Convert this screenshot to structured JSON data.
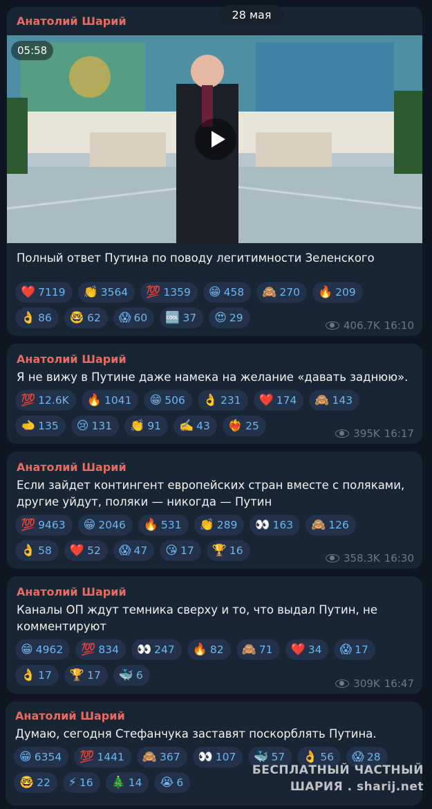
{
  "date_badge": "28 мая",
  "messages": [
    {
      "author": "Анатолий Шарий",
      "video_duration": "05:58",
      "text": "Полный ответ Путина по поводу легитимности Зеленского",
      "reactions": [
        {
          "emoji": "❤️",
          "count": "7119"
        },
        {
          "emoji": "👏",
          "count": "3564"
        },
        {
          "emoji": "💯",
          "count": "1359"
        },
        {
          "emoji": "😁",
          "count": "458"
        },
        {
          "emoji": "🙈",
          "count": "270"
        },
        {
          "emoji": "🔥",
          "count": "209"
        },
        {
          "emoji": "👌",
          "count": "86"
        },
        {
          "emoji": "🤓",
          "count": "62"
        },
        {
          "emoji": "😱",
          "count": "60"
        },
        {
          "emoji": "🆒",
          "count": "37"
        },
        {
          "emoji": "😍",
          "count": "29"
        }
      ],
      "views": "406.7K",
      "time": "16:10"
    },
    {
      "author": "Анатолий Шарий",
      "text": "Я не вижу в Путине даже намека на желание «давать заднюю».",
      "reactions": [
        {
          "emoji": "💯",
          "count": "12.6K"
        },
        {
          "emoji": "🔥",
          "count": "1041"
        },
        {
          "emoji": "😁",
          "count": "506"
        },
        {
          "emoji": "👌",
          "count": "231"
        },
        {
          "emoji": "❤️",
          "count": "174"
        },
        {
          "emoji": "🙈",
          "count": "143"
        },
        {
          "emoji": "🫲",
          "count": "135"
        },
        {
          "emoji": "😢",
          "count": "131"
        },
        {
          "emoji": "👏",
          "count": "91"
        },
        {
          "emoji": "✍️",
          "count": "43"
        },
        {
          "emoji": "❤️‍🔥",
          "count": "25"
        }
      ],
      "views": "395K",
      "time": "16:17"
    },
    {
      "author": "Анатолий Шарий",
      "text": "Если зайдет контингент европейских стран вместе с поляками,\nдругие уйдут, поляки — никогда — Путин",
      "reactions": [
        {
          "emoji": "💯",
          "count": "9463"
        },
        {
          "emoji": "😁",
          "count": "2046"
        },
        {
          "emoji": "🔥",
          "count": "531"
        },
        {
          "emoji": "👏",
          "count": "289"
        },
        {
          "emoji": "👀",
          "count": "163"
        },
        {
          "emoji": "🙈",
          "count": "126"
        },
        {
          "emoji": "👌",
          "count": "58"
        },
        {
          "emoji": "❤️",
          "count": "52"
        },
        {
          "emoji": "😱",
          "count": "47"
        },
        {
          "emoji": "😘",
          "count": "17"
        },
        {
          "emoji": "🏆",
          "count": "16"
        }
      ],
      "views": "358.3K",
      "time": "16:30"
    },
    {
      "author": "Анатолий Шарий",
      "text": "Каналы ОП ждут темника сверху и то, что выдал Путин, не\nкомментируют",
      "reactions": [
        {
          "emoji": "😁",
          "count": "4962"
        },
        {
          "emoji": "💯",
          "count": "834"
        },
        {
          "emoji": "👀",
          "count": "247"
        },
        {
          "emoji": "🔥",
          "count": "82"
        },
        {
          "emoji": "🙈",
          "count": "71"
        },
        {
          "emoji": "❤️",
          "count": "34"
        },
        {
          "emoji": "😱",
          "count": "17"
        },
        {
          "emoji": "👌",
          "count": "17"
        },
        {
          "emoji": "🏆",
          "count": "17"
        },
        {
          "emoji": "🐳",
          "count": "6"
        }
      ],
      "views": "309K",
      "time": "16:47"
    },
    {
      "author": "Анатолий Шарий",
      "text": "Думаю, сегодня Стефанчука заставят поскорблять Путина.",
      "reactions": [
        {
          "emoji": "😁",
          "count": "6354"
        },
        {
          "emoji": "💯",
          "count": "1441"
        },
        {
          "emoji": "🙈",
          "count": "367"
        },
        {
          "emoji": "👀",
          "count": "107"
        },
        {
          "emoji": "🐳",
          "count": "57"
        },
        {
          "emoji": "👌",
          "count": "56"
        },
        {
          "emoji": "😱",
          "count": "28"
        },
        {
          "emoji": "🤓",
          "count": "22"
        },
        {
          "emoji": "⚡",
          "count": "16"
        },
        {
          "emoji": "🎄",
          "count": "14"
        },
        {
          "emoji": "😭",
          "count": "6"
        }
      ],
      "views": "",
      "time": ""
    }
  ],
  "watermark": {
    "line1": "БЕСПЛАТНЫЙ ЧАСТНЫЙ",
    "line2": "ШАРИЯ . sharij.net"
  }
}
